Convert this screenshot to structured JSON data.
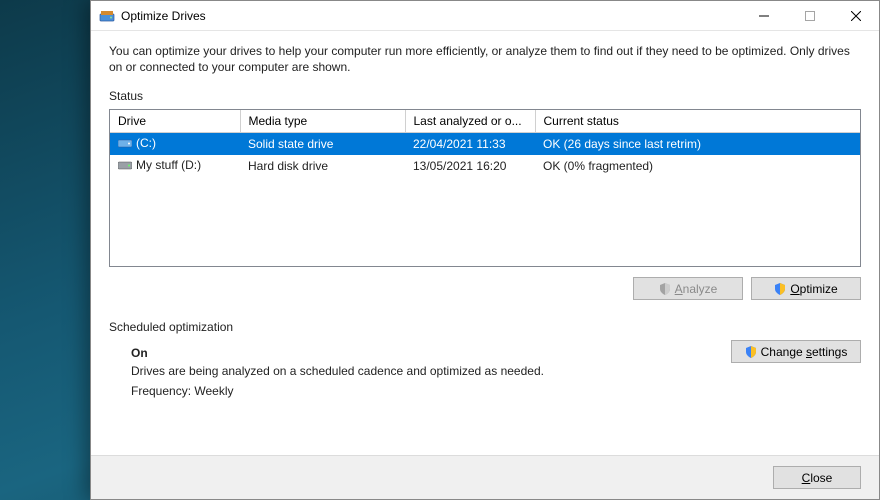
{
  "window": {
    "title": "Optimize Drives",
    "intro": "You can optimize your drives to help your computer run more efficiently, or analyze them to find out if they need to be optimized. Only drives on or connected to your computer are shown."
  },
  "status": {
    "label": "Status",
    "headers": {
      "drive": "Drive",
      "media": "Media type",
      "last": "Last analyzed or o...",
      "status": "Current status"
    },
    "rows": [
      {
        "selected": true,
        "icon": "drive-ssd-icon",
        "drive": "(C:)",
        "media": "Solid state drive",
        "last": "22/04/2021 11:33",
        "status": "OK (26 days since last retrim)"
      },
      {
        "selected": false,
        "icon": "drive-hdd-icon",
        "drive": "My stuff (D:)",
        "media": "Hard disk drive",
        "last": "13/05/2021 16:20",
        "status": "OK (0% fragmented)"
      }
    ]
  },
  "buttons": {
    "analyze_pre": "",
    "analyze_u": "A",
    "analyze_post": "nalyze",
    "optimize_pre": "",
    "optimize_u": "O",
    "optimize_post": "ptimize",
    "change_settings_pre": "Change ",
    "change_settings_u": "s",
    "change_settings_post": "ettings"
  },
  "schedule": {
    "label": "Scheduled optimization",
    "state": "On",
    "desc": "Drives are being analyzed on a scheduled cadence and optimized as needed.",
    "freq_label": "Frequency:",
    "freq_value": "Weekly"
  },
  "footer": {
    "close_pre": "",
    "close_u": "C",
    "close_post": "lose"
  }
}
